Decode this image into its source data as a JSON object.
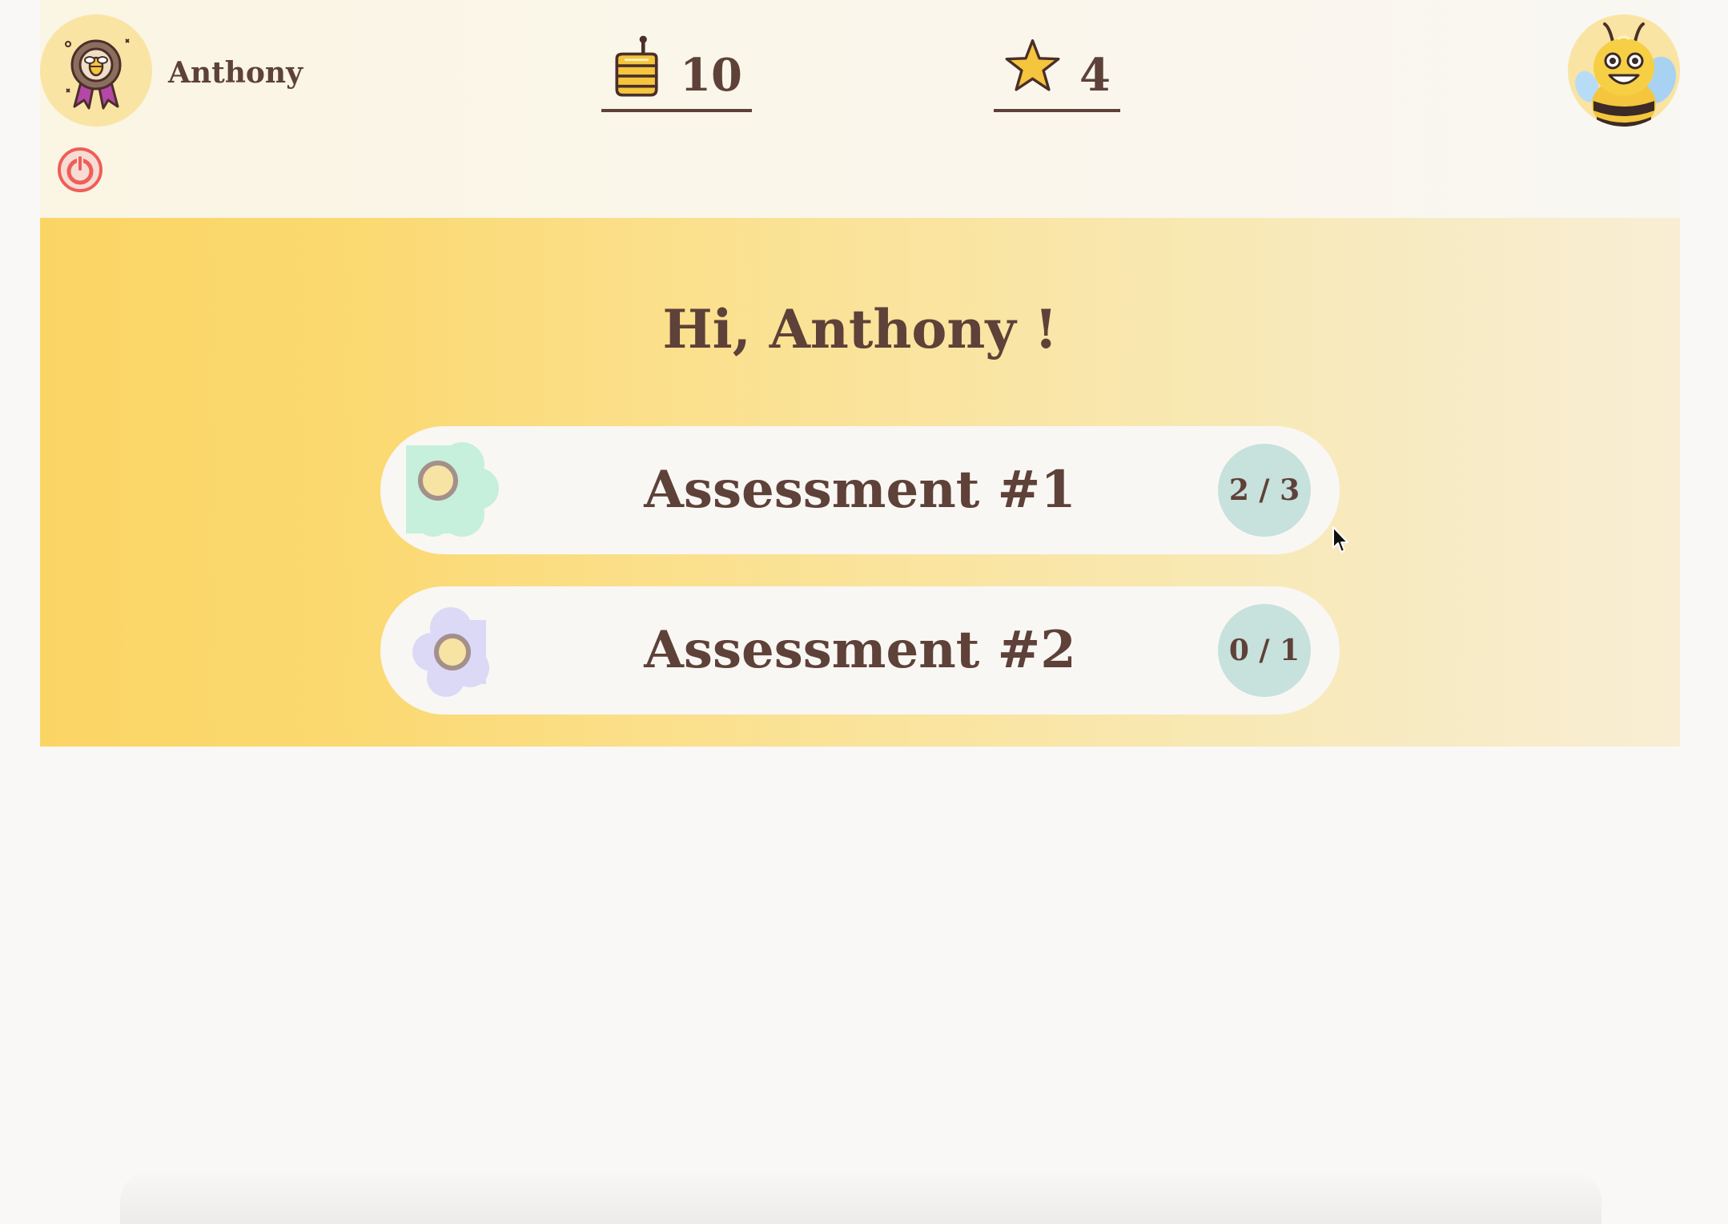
{
  "header": {
    "username": "Anthony",
    "honey_count": "10",
    "star_count": "4",
    "icons": {
      "left_avatar": "bee-badge-icon",
      "logout": "power-icon",
      "honey": "honey-jar-icon",
      "star": "star-icon",
      "right_avatar": "bee-mascot-icon"
    }
  },
  "main": {
    "greeting": "Hi, Anthony !",
    "assessments": [
      {
        "title": "Assessment #1",
        "score": "2 / 3",
        "flower_color": "#c6efdc",
        "flower_icon": "flower-icon"
      },
      {
        "title": "Assessment #2",
        "score": "0 / 1",
        "flower_color": "#dcd9f7",
        "flower_icon": "flower-icon"
      }
    ]
  },
  "colors": {
    "text": "#5e4138",
    "banner_start": "#fbd564",
    "banner_end": "#f9eed4",
    "score_badge": "#c7e1dc",
    "avatar_bg": "#f9e4a4",
    "power_icon": "#ef5e57"
  }
}
